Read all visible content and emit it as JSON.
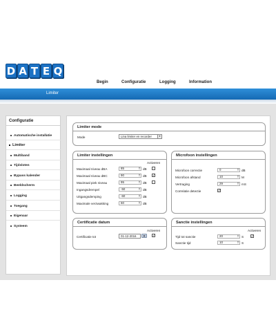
{
  "logo": {
    "letters": [
      "D",
      "A",
      "T",
      "E",
      "Q"
    ]
  },
  "nav": {
    "begin": "Begin",
    "configuratie": "Configuratie",
    "logging": "Logging",
    "information": "Information"
  },
  "page": {
    "subtitle": "Limiter"
  },
  "sidebar": {
    "title": "Configuratie",
    "items": [
      {
        "label": "Automatische installatie"
      },
      {
        "label": "Limiter"
      },
      {
        "label": "Multiband"
      },
      {
        "label": "Tijdsloten"
      },
      {
        "label": "Bypass kalender"
      },
      {
        "label": "Beeldscherm"
      },
      {
        "label": "Logging"
      },
      {
        "label": "Toegang"
      },
      {
        "label": "Eigenaar"
      },
      {
        "label": "Systeem"
      }
    ]
  },
  "limiter_mode": {
    "title": "Limiter mode",
    "mode_label": "Mode",
    "mode_value": "Lina limiter en recorder"
  },
  "limiter_settings": {
    "title": "Limiter instellingen",
    "activate_header": "Activeren",
    "rows": [
      {
        "label": "Maximaal niveau dBA",
        "value": "85",
        "unit": "dB",
        "check": ""
      },
      {
        "label": "Maximaal niveau dBC",
        "value": "90",
        "unit": "dB",
        "check": "✓"
      },
      {
        "label": "Maximaal piek niveau",
        "value": "95",
        "unit": "dB",
        "check": ""
      },
      {
        "label": "Ingangsdrempel",
        "value": "-50",
        "unit": "dB"
      },
      {
        "label": "Uitgangsdemping",
        "value": "-60",
        "unit": "dB"
      },
      {
        "label": "Maximale verzwakking",
        "value": "60",
        "unit": "dB"
      }
    ]
  },
  "mic_settings": {
    "title": "Microfoon instellingen",
    "rows": [
      {
        "label": "Microfoon correctie",
        "value": "0",
        "unit": "dB"
      },
      {
        "label": "Microfoon afstand",
        "value": "10",
        "unit": "M"
      },
      {
        "label": "Vertraging",
        "value": "29",
        "unit": "mS"
      },
      {
        "label": "Correlatie detectie",
        "check": "✓"
      }
    ]
  },
  "certificate": {
    "title": "Certificatie datum",
    "activate_header": "Activeren",
    "label": "Certificatie tot",
    "value": "01-12-2016",
    "check": "✓"
  },
  "sanction": {
    "title": "Sanctie instellingen",
    "activate_header": "Activeren",
    "rows": [
      {
        "label": "Tijd tot sanctie",
        "value": "20",
        "unit": "S",
        "check": "✓"
      },
      {
        "label": "Sanctie tijd",
        "value": "10",
        "unit": "S"
      }
    ]
  },
  "colors": {
    "accent": "#1c72c4",
    "bar": "#1f7ac8",
    "background": "#e3e3e3"
  }
}
